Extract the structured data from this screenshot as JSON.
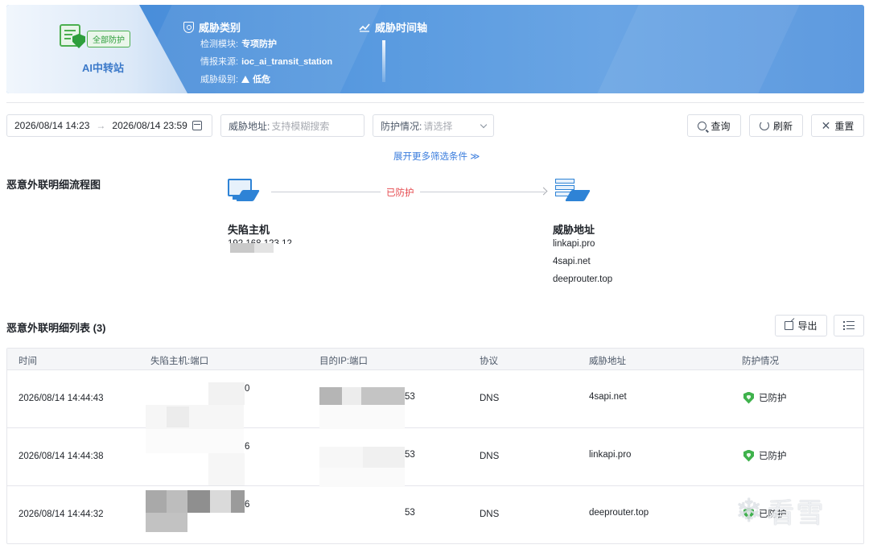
{
  "banner": {
    "asset_tag": "全部防护",
    "asset_name": "AI中转站",
    "category_title": "威胁类别",
    "detect_module_label": "检测模块:",
    "detect_module_value": "专项防护",
    "intel_source_label": "情报来源:",
    "intel_source_value": "ioc_ai_transit_station",
    "threat_level_label": "威胁级别:",
    "threat_level_value": "低危",
    "timeline_title": "威胁时间轴"
  },
  "filters": {
    "date_start": "2026/08/14 14:23",
    "date_arrow": "→",
    "date_end": "2026/08/14 23:59",
    "address_label": "威胁地址:",
    "address_placeholder": "支持模糊搜索",
    "status_label": "防护情况:",
    "status_placeholder": "请选择",
    "query_label": "查询",
    "refresh_label": "刷新",
    "reset_label": "重置",
    "expand_label": "展开更多筛选条件 ≫"
  },
  "flow": {
    "title": "恶意外联明细流程图",
    "status": "已防护",
    "source_title": "失陷主机",
    "source_value": "192.168.123.12",
    "target_title": "威胁地址",
    "targets": [
      "linkapi.pro",
      "4sapi.net",
      "deeprouter.top"
    ]
  },
  "list": {
    "title": "恶意外联明细列表 (3)",
    "export_label": "导出",
    "columns": [
      "时间",
      "失陷主机:端口",
      "目的IP:端口",
      "协议",
      "威胁地址",
      "防护情况"
    ],
    "rows": [
      {
        "time": "2026/08/14 14:44:43",
        "host_suffix": "0",
        "dest_suffix": "53",
        "protocol": "DNS",
        "address": "4sapi.net",
        "status": "已防护"
      },
      {
        "time": "2026/08/14 14:44:38",
        "host_suffix": "6",
        "dest_suffix": "53",
        "protocol": "DNS",
        "address": "linkapi.pro",
        "status": "已防护"
      },
      {
        "time": "2026/08/14 14:44:32",
        "host_suffix": "6",
        "dest_suffix": "53",
        "protocol": "DNS",
        "address": "deeprouter.top",
        "status": "已防护"
      }
    ]
  },
  "watermark": {
    "text": "看雪"
  },
  "colors": {
    "accent": "#3b7ddd",
    "danger": "#e5484d",
    "success": "#3fb24c",
    "banner": "#4a8fdb"
  }
}
